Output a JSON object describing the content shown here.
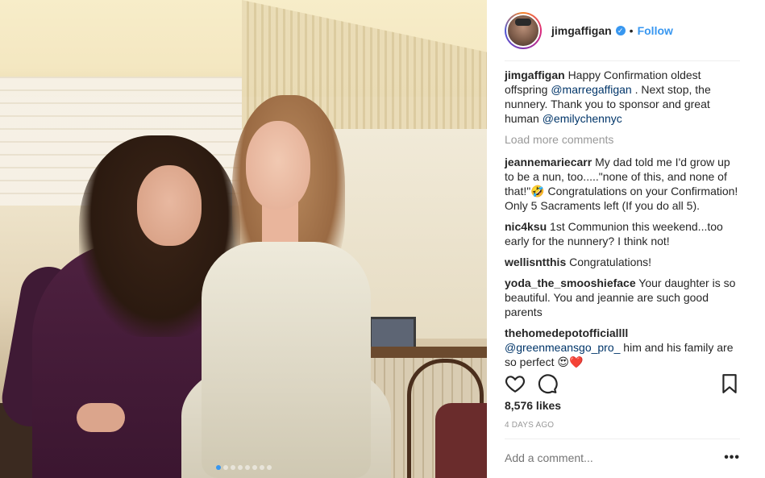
{
  "post": {
    "author": "jimgaffigan",
    "follow_label": "Follow",
    "separator": "•",
    "verified_mark": "✓",
    "carousel": {
      "total": 8,
      "active": 0
    }
  },
  "caption": {
    "user": "jimgaffigan",
    "text_1": "Happy Confirmation oldest offspring ",
    "mention_1": "@marregaffigan",
    "text_2": " . Next stop, the nunnery. Thank you to sponsor and great human ",
    "mention_2": "@emilychennyc"
  },
  "load_more_label": "Load more comments",
  "comments": [
    {
      "user": "jeannemariecarr",
      "text": "My dad told me I'd grow up to be a nun, too.....\"none of this, and none of that!\"🤣 Congratulations on your Confirmation! Only 5 Sacraments left (If you do all 5)."
    },
    {
      "user": "nic4ksu",
      "text": "1st Communion this weekend...too early for the nunnery? I think not!"
    },
    {
      "user": "wellisntthis",
      "text": "Congratulations!"
    },
    {
      "user": "yoda_the_smooshieface",
      "text": "Your daughter is so beautiful. You and jeannie are such good parents"
    },
    {
      "user": "thehomedepotofficiallll",
      "mention": "@greenmeansgo_pro_",
      "text": " him and his family are so perfect 😍❤️"
    }
  ],
  "icons": {
    "like": "heart-icon",
    "comment": "comment-bubble-icon",
    "save": "bookmark-icon",
    "more": "more-options-icon"
  },
  "likes": "8,576 likes",
  "time": "4 DAYS AGO",
  "add_comment_placeholder": "Add a comment...",
  "more_label": "•••",
  "colors": {
    "link": "#3897f0",
    "mention": "#003569",
    "muted": "#999999",
    "text": "#262626"
  }
}
